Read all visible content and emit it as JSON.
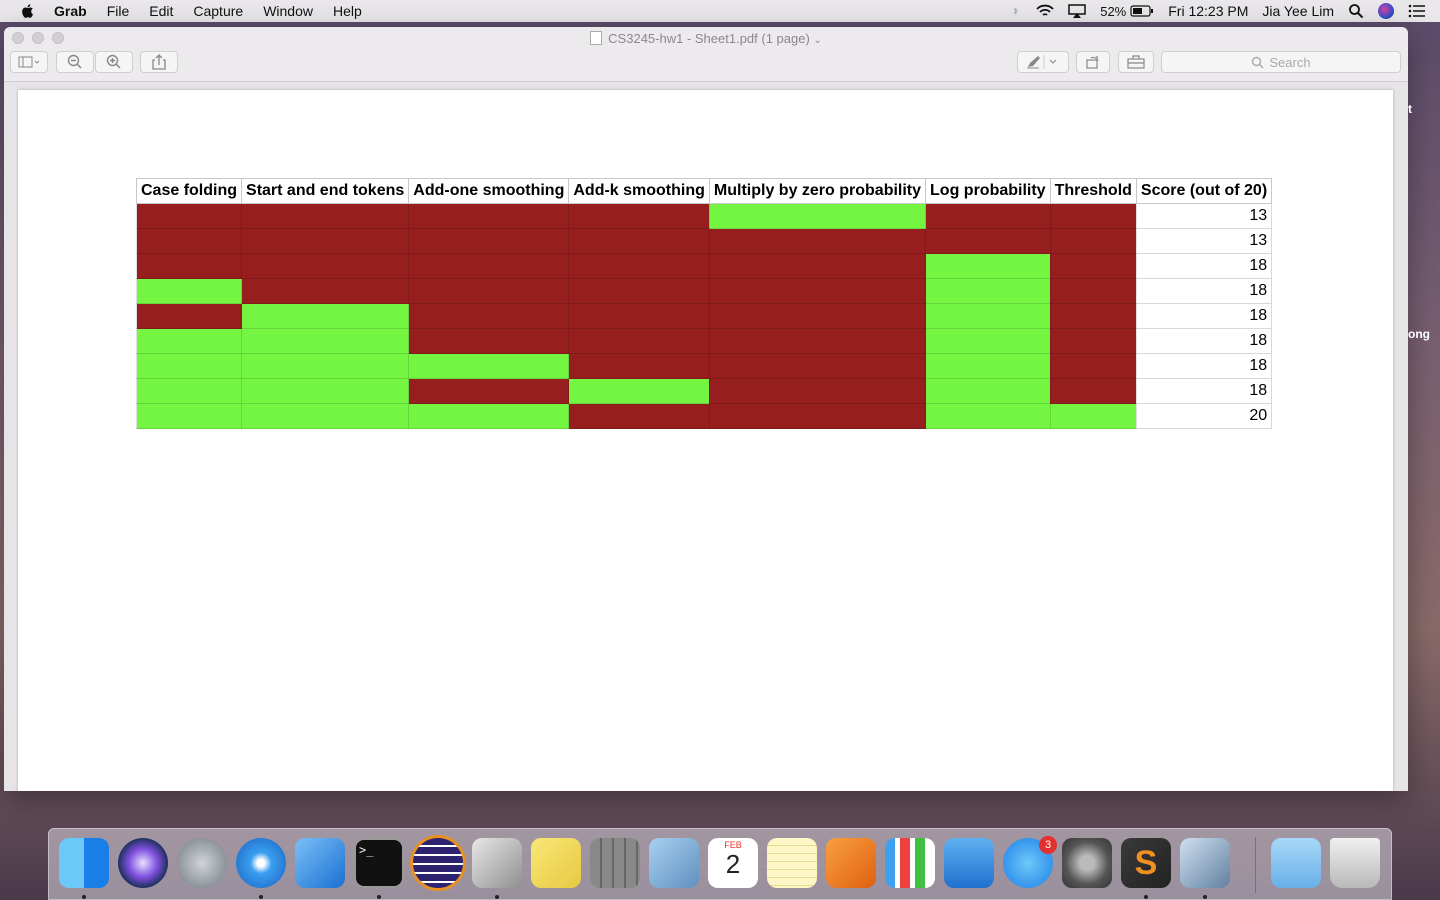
{
  "menubar": {
    "app_name": "Grab",
    "menus": [
      "File",
      "Edit",
      "Capture",
      "Window",
      "Help"
    ],
    "battery": "52%",
    "clock": "Fri 12:23 PM",
    "user": "Jia Yee Lim"
  },
  "window": {
    "title": "CS3245-hw1 - Sheet1.pdf (1 page)",
    "search_placeholder": "Search"
  },
  "sheet": {
    "headers": [
      "Case folding",
      "Start and end tokens",
      "Add-one smoothing",
      "Add-k smoothing",
      "Multiply by zero probability",
      "Log probability",
      "Threshold",
      "Score (out of 20)"
    ],
    "rows": [
      {
        "flags": [
          0,
          0,
          0,
          0,
          1,
          0,
          0
        ],
        "score": "13"
      },
      {
        "flags": [
          0,
          0,
          0,
          0,
          0,
          0,
          0
        ],
        "score": "13"
      },
      {
        "flags": [
          0,
          0,
          0,
          0,
          0,
          1,
          0
        ],
        "score": "18"
      },
      {
        "flags": [
          1,
          0,
          0,
          0,
          0,
          1,
          0
        ],
        "score": "18"
      },
      {
        "flags": [
          0,
          1,
          0,
          0,
          0,
          1,
          0
        ],
        "score": "18"
      },
      {
        "flags": [
          1,
          1,
          0,
          0,
          0,
          1,
          0
        ],
        "score": "18"
      },
      {
        "flags": [
          1,
          1,
          1,
          0,
          0,
          1,
          0
        ],
        "score": "18"
      },
      {
        "flags": [
          1,
          1,
          0,
          1,
          0,
          1,
          0
        ],
        "score": "18"
      },
      {
        "flags": [
          1,
          1,
          1,
          0,
          0,
          1,
          1
        ],
        "score": "20"
      }
    ],
    "colors": {
      "on": "#74f542",
      "off": "#961e1e"
    }
  },
  "wallpaper_text": {
    "edge_top": "t",
    "edge_mid": "ong"
  },
  "dock": {
    "badge_count": "3",
    "apps": [
      "finder-icon",
      "siri-icon",
      "launchpad-icon",
      "safari-icon",
      "xcode-icon",
      "terminal-icon",
      "eclipse-icon",
      "grab-scissors-icon",
      "stickies-icon",
      "calculator-icon",
      "mail-bird-icon",
      "calendar-icon",
      "notes-icon",
      "pages-icon",
      "numbers-icon",
      "keynote-icon",
      "app-store-icon",
      "system-preferences-icon",
      "sublime-text-icon",
      "preview-icon",
      "documents-folder-icon",
      "trash-icon"
    ],
    "calendar_month": "FEB",
    "calendar_day": "2"
  }
}
